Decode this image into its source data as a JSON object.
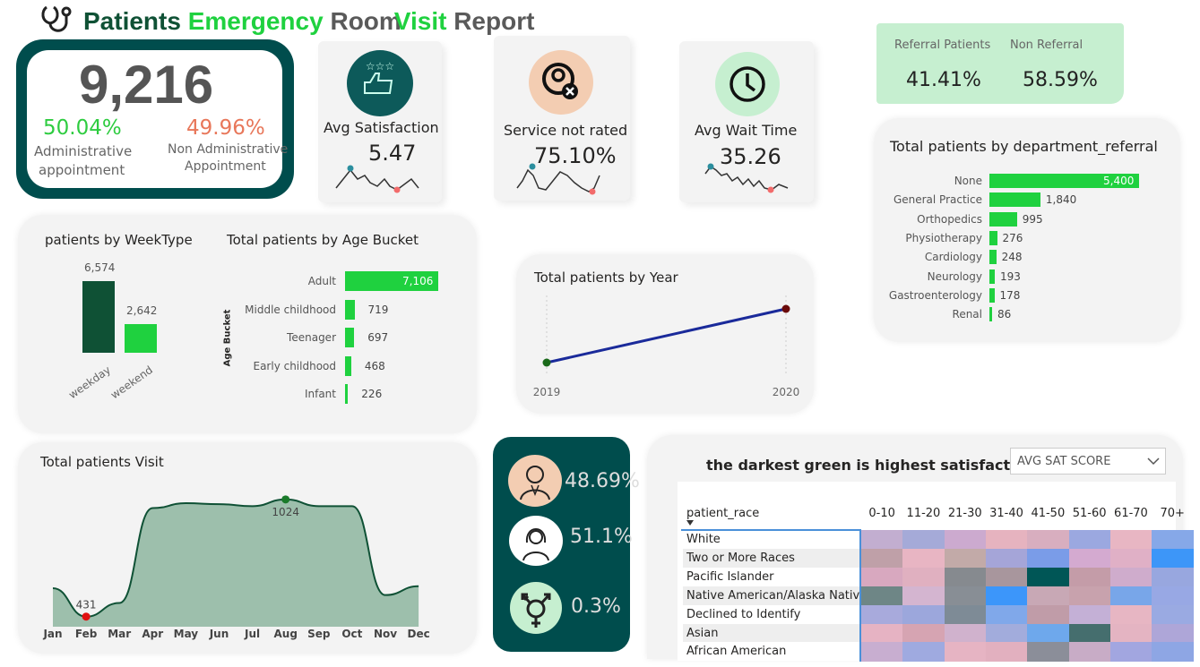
{
  "title": {
    "w1": "Patients",
    "w2": "Emergency",
    "w3": "Room",
    "w4": "Visit",
    "w5": "Report"
  },
  "colors": {
    "dark_teal": "#004d4d",
    "green": "#1fd13f",
    "dark_green": "#0f5135",
    "orange": "#e8775a",
    "light_green": "#c6efd0"
  },
  "kpi": {
    "total": "9,216",
    "admin_pct": "50.04%",
    "admin_label_1": "Administrative",
    "admin_label_2": "appointment",
    "nonadmin_pct": "49.96%",
    "nonadmin_label_1": "Non Administrative",
    "nonadmin_label_2": "Appointment"
  },
  "satisfaction": {
    "label": "Avg Satisfaction",
    "value": "5.47",
    "icon": "thumbs-up-stars-icon"
  },
  "not_rated": {
    "label": "Service not rated",
    "value": "75.10%",
    "icon": "user-x-icon"
  },
  "wait": {
    "label": "Avg Wait Time",
    "value": "35.26",
    "icon": "clock-icon"
  },
  "referral": {
    "ref_label": "Referral Patients",
    "ref_value": "41.41%",
    "non_label": "Non Referral",
    "non_value": "58.59%"
  },
  "gender": [
    {
      "icon": "male-icon",
      "value": "48.69%"
    },
    {
      "icon": "female-icon",
      "value": "51.1%"
    },
    {
      "icon": "transgender-icon",
      "value": "0.3%"
    }
  ],
  "heatmap": {
    "title": "the darkest green is highest satisfaction",
    "dropdown": "AVG SAT SCORE",
    "row_header": "patient_race",
    "columns": [
      "0-10",
      "11-20",
      "21-30",
      "31-40",
      "41-50",
      "51-60",
      "61-70",
      "70+"
    ],
    "rows": [
      "White",
      "Two or More Races",
      "Pacific Islander",
      "Native American/Alaska Native",
      "Declined to Identify",
      "Asian",
      "African American"
    ],
    "cell_colors": [
      [
        "#c2aed0",
        "#a5aad8",
        "#ccaacf",
        "#e6b3bf",
        "#d8aebf",
        "#9ba8e0",
        "#e8b6c3",
        "#86a8e8"
      ],
      [
        "#bfa0a8",
        "#e8b5c3",
        "#c2aaa8",
        "#a5a5d8",
        "#7a9ce8",
        "#d4aad0",
        "#e0b0c6",
        "#3d96f8"
      ],
      [
        "#d8a8bf",
        "#e0b0c0",
        "#868a8f",
        "#a8969d",
        "#005656",
        "#c49ca8",
        "#cfaccc",
        "#98a7df"
      ],
      [
        "#6e8686",
        "#d4b5d0",
        "#888e95",
        "#3c96fa",
        "#c8a8b5",
        "#c8a2ad",
        "#78a6e9",
        "#98a8e4"
      ],
      [
        "#a8aadc",
        "#9ca7dc",
        "#7e8b96",
        "#80a8ea",
        "#c09ca8",
        "#c4b0d6",
        "#e7b6c3",
        "#9aaae2"
      ],
      [
        "#e6b3c3",
        "#d6a4b2",
        "#d0b2cd",
        "#a2acdc",
        "#6ea8ec",
        "#456e6e",
        "#e4b4c2",
        "#aea6d8"
      ],
      [
        "#c8aed0",
        "#9faae0",
        "#e6b4c3",
        "#e2b0bf",
        "#8b8e99",
        "#c8acc6",
        "#a2a6e0",
        "#8ea6e4"
      ]
    ]
  },
  "chart_data": [
    {
      "type": "bar",
      "title": "Total patients by department_referral",
      "categories": [
        "None",
        "General Practice",
        "Orthopedics",
        "Physiotherapy",
        "Cardiology",
        "Neurology",
        "Gastroenterology",
        "Renal"
      ],
      "values": [
        5400,
        1840,
        995,
        276,
        248,
        193,
        178,
        86
      ],
      "value_labels": [
        "5,400",
        "1,840",
        "995",
        "276",
        "248",
        "193",
        "178",
        "86"
      ],
      "xlim": [
        0,
        5400
      ]
    },
    {
      "type": "bar",
      "title": "patients by WeekType",
      "categories": [
        "weekday",
        "weekend"
      ],
      "values": [
        6574,
        2642
      ],
      "value_labels": [
        "6,574",
        "2,642"
      ],
      "ylim": [
        0,
        6574
      ]
    },
    {
      "type": "bar",
      "title": "Total patients by Age Bucket",
      "ylabel": "Age Bucket",
      "categories": [
        "Adult",
        "Middle childhood",
        "Teenager",
        "Early childhood",
        "Infant"
      ],
      "values": [
        7106,
        719,
        697,
        468,
        226
      ],
      "value_labels": [
        "7,106",
        "719",
        "697",
        "468",
        "226"
      ],
      "xlim": [
        0,
        7106
      ]
    },
    {
      "type": "line",
      "title": "Total patients by Year",
      "x": [
        "2019",
        "2020"
      ],
      "values": [
        100,
        340
      ],
      "ylim": [
        0,
        400
      ]
    },
    {
      "type": "area",
      "title": "Total patients Visit",
      "categories": [
        "Jan",
        "Feb",
        "Mar",
        "Apr",
        "May",
        "Jun",
        "Jul",
        "Aug",
        "Sep",
        "Oct",
        "Nov",
        "Dec"
      ],
      "values": [
        575,
        431,
        500,
        980,
        1005,
        1000,
        990,
        1024,
        990,
        990,
        540,
        585
      ],
      "ylim": [
        380,
        1150
      ],
      "min_label": "431",
      "max_label": "1024"
    }
  ]
}
